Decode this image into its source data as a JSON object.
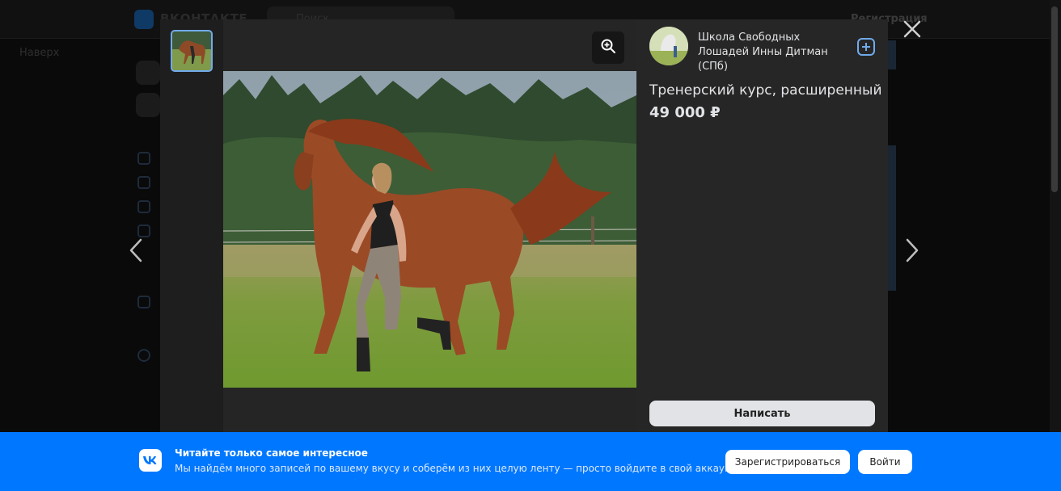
{
  "background": {
    "logo_text": "ВКОНТАКТЕ",
    "search_placeholder": "Поиск",
    "register_label": "Регистрация",
    "back_to_top": "Наверх"
  },
  "viewer": {
    "group": {
      "name": "Школа Свободных Лошадей Инны Дитман (СПб)",
      "add_icon": "plus-square-icon"
    },
    "product": {
      "title": "Тренерский курс, расширенный",
      "price": "49 000 ₽"
    },
    "write_button": "Написать",
    "zoom_icon": "zoom-in-icon",
    "close_icon": "close-icon",
    "prev_icon": "chevron-left-icon",
    "next_icon": "chevron-right-icon"
  },
  "banner": {
    "title": "Читайте только самое интересное",
    "text": "Мы найдём много записей по вашему вкусу и соберём из них целую ленту — просто войдите в свой аккаунт.",
    "register_button": "Зарегистрироваться",
    "login_button": "Войти"
  },
  "colors": {
    "accent": "#0077ff",
    "link": "#71aaeb",
    "modal_bg": "#1e1e1e",
    "panel_bg": "#262626"
  }
}
